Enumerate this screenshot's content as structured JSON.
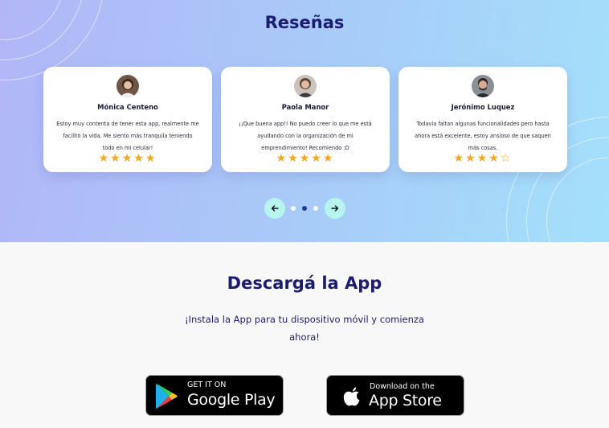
{
  "reviews": {
    "title": "Reseñas",
    "cards": [
      {
        "name": "Mónica Centeno",
        "text": "Estoy muy contenta de tener esta app, realmente me facilitó la vida. Me siento más tranquila teniendo todo en mi celular!",
        "rating": 5,
        "stars": "★★★★★"
      },
      {
        "name": "Paola Manor",
        "text": "¡¡Que buena app!! No puedo creer lo que me está ayudando con la organización de mi emprendimiento! Recomiendo :D",
        "rating": 5,
        "stars": "★★★★★"
      },
      {
        "name": "Jerónimo Luquez",
        "text": "Todavía faltan algunas funcionalidades pero hasta ahora está excelente, estoy ansioso de que saquen más cosas.",
        "rating": 4,
        "stars": "★★★★☆"
      }
    ],
    "pagination": {
      "total": 3,
      "active": 2
    }
  },
  "download": {
    "title": "Descargá la App",
    "subtitle": "¡Instala la App para tu dispositivo móvil y comienza ahora!",
    "google_play": {
      "small": "GET IT ON",
      "big": "Google Play"
    },
    "app_store": {
      "small": "Download on the",
      "big": "App Store"
    }
  },
  "colors": {
    "title": "#1c1d6e",
    "star": "#f5a623",
    "nav_button": "#b6f4ee",
    "dot_active": "#2b3794"
  },
  "icons": [
    "arrow-left-icon",
    "arrow-right-icon",
    "google-play-logo-icon",
    "apple-logo-icon",
    "star-icon"
  ]
}
